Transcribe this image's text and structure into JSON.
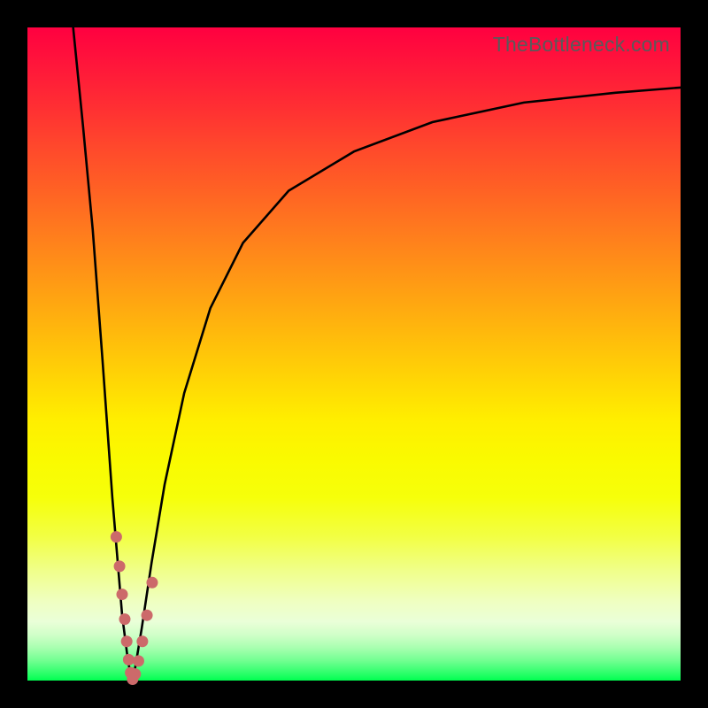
{
  "watermark": "TheBottleneck.com",
  "chart_data": {
    "type": "line",
    "title": "",
    "xlabel": "",
    "ylabel": "",
    "xlim": [
      0,
      100
    ],
    "ylim": [
      0,
      100
    ],
    "series": [
      {
        "name": "left-curve",
        "x": [
          7.0,
          8.5,
          10.0,
          11.5,
          13.0,
          14.5,
          15.4,
          15.8,
          16.1
        ],
        "y": [
          100,
          85,
          69,
          49,
          28,
          10,
          3,
          1,
          0
        ]
      },
      {
        "name": "right-curve",
        "x": [
          16.1,
          16.5,
          17.5,
          19.0,
          21.0,
          24.0,
          28.0,
          33.0,
          40.0,
          50.0,
          62.0,
          76.0,
          90.0,
          100.0
        ],
        "y": [
          0,
          2,
          8,
          18,
          30,
          44,
          57,
          67,
          75,
          81,
          85.5,
          88.5,
          90,
          90.8
        ]
      },
      {
        "name": "dots",
        "kind": "scatter",
        "color": "#cc6a6a",
        "x": [
          13.6,
          14.1,
          14.5,
          14.9,
          15.2,
          15.5,
          15.8,
          16.1,
          16.5,
          17.0,
          17.6,
          18.3,
          19.1
        ],
        "y": [
          22,
          17.5,
          13.2,
          9.4,
          6.0,
          3.2,
          1.2,
          0.2,
          1.0,
          3.0,
          6.0,
          10.0,
          15.0
        ]
      }
    ]
  }
}
